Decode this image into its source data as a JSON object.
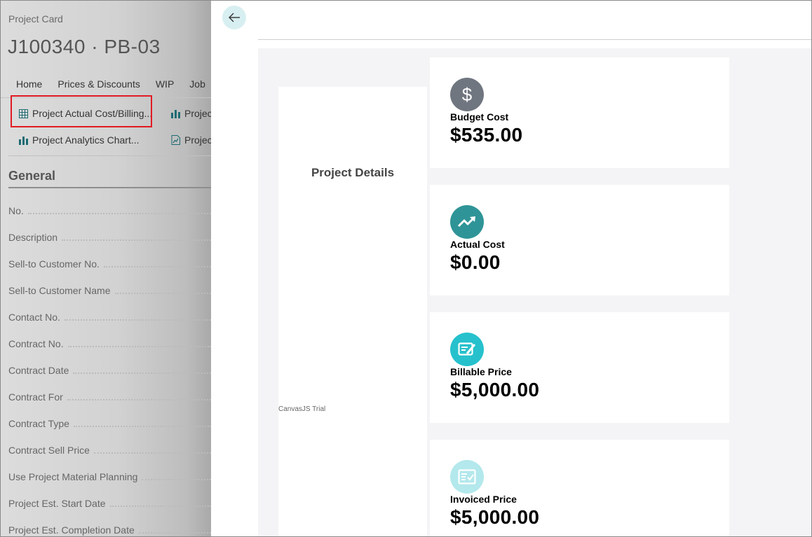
{
  "card": {
    "label": "Project Card",
    "title": "J100340 · PB-03",
    "tabs": [
      "Home",
      "Prices & Discounts",
      "WIP",
      "Job"
    ],
    "actions": {
      "actual_cost_billing": "Project Actual Cost/Billing...",
      "project_chart_partial": "Projec",
      "analytics_chart": "Project Analytics Chart...",
      "project_report_partial": "Projec"
    },
    "section_title": "General",
    "fields": [
      "No.",
      "Description",
      "Sell-to Customer No.",
      "Sell-to Customer Name",
      "Contact No.",
      "Contract No.",
      "Contract Date",
      "Contract For",
      "Contract Type",
      "Contract Sell Price",
      "Use Project Material Planning",
      "Project Est. Start Date",
      "Project Est. Completion Date"
    ]
  },
  "panel": {
    "back_icon": "arrow-left-icon",
    "details_title": "Project Details",
    "trial_text": "CanvasJS Trial",
    "kpis": [
      {
        "label": "Budget Cost",
        "value": "$535.00",
        "icon": "dollar-icon",
        "color": "#707680"
      },
      {
        "label": "Actual Cost",
        "value": "$0.00",
        "icon": "trend-up-icon",
        "color": "#2f9497"
      },
      {
        "label": "Billable Price",
        "value": "$5,000.00",
        "icon": "edit-document-icon",
        "color": "#26c1cc"
      },
      {
        "label": "Invoiced Price",
        "value": "$5,000.00",
        "icon": "check-document-icon",
        "color": "#b3e8ec"
      }
    ]
  },
  "colors": {
    "highlight_border": "#e11b22",
    "back_button_bg": "#d8eff1",
    "content_bg": "#f4f4f6"
  }
}
